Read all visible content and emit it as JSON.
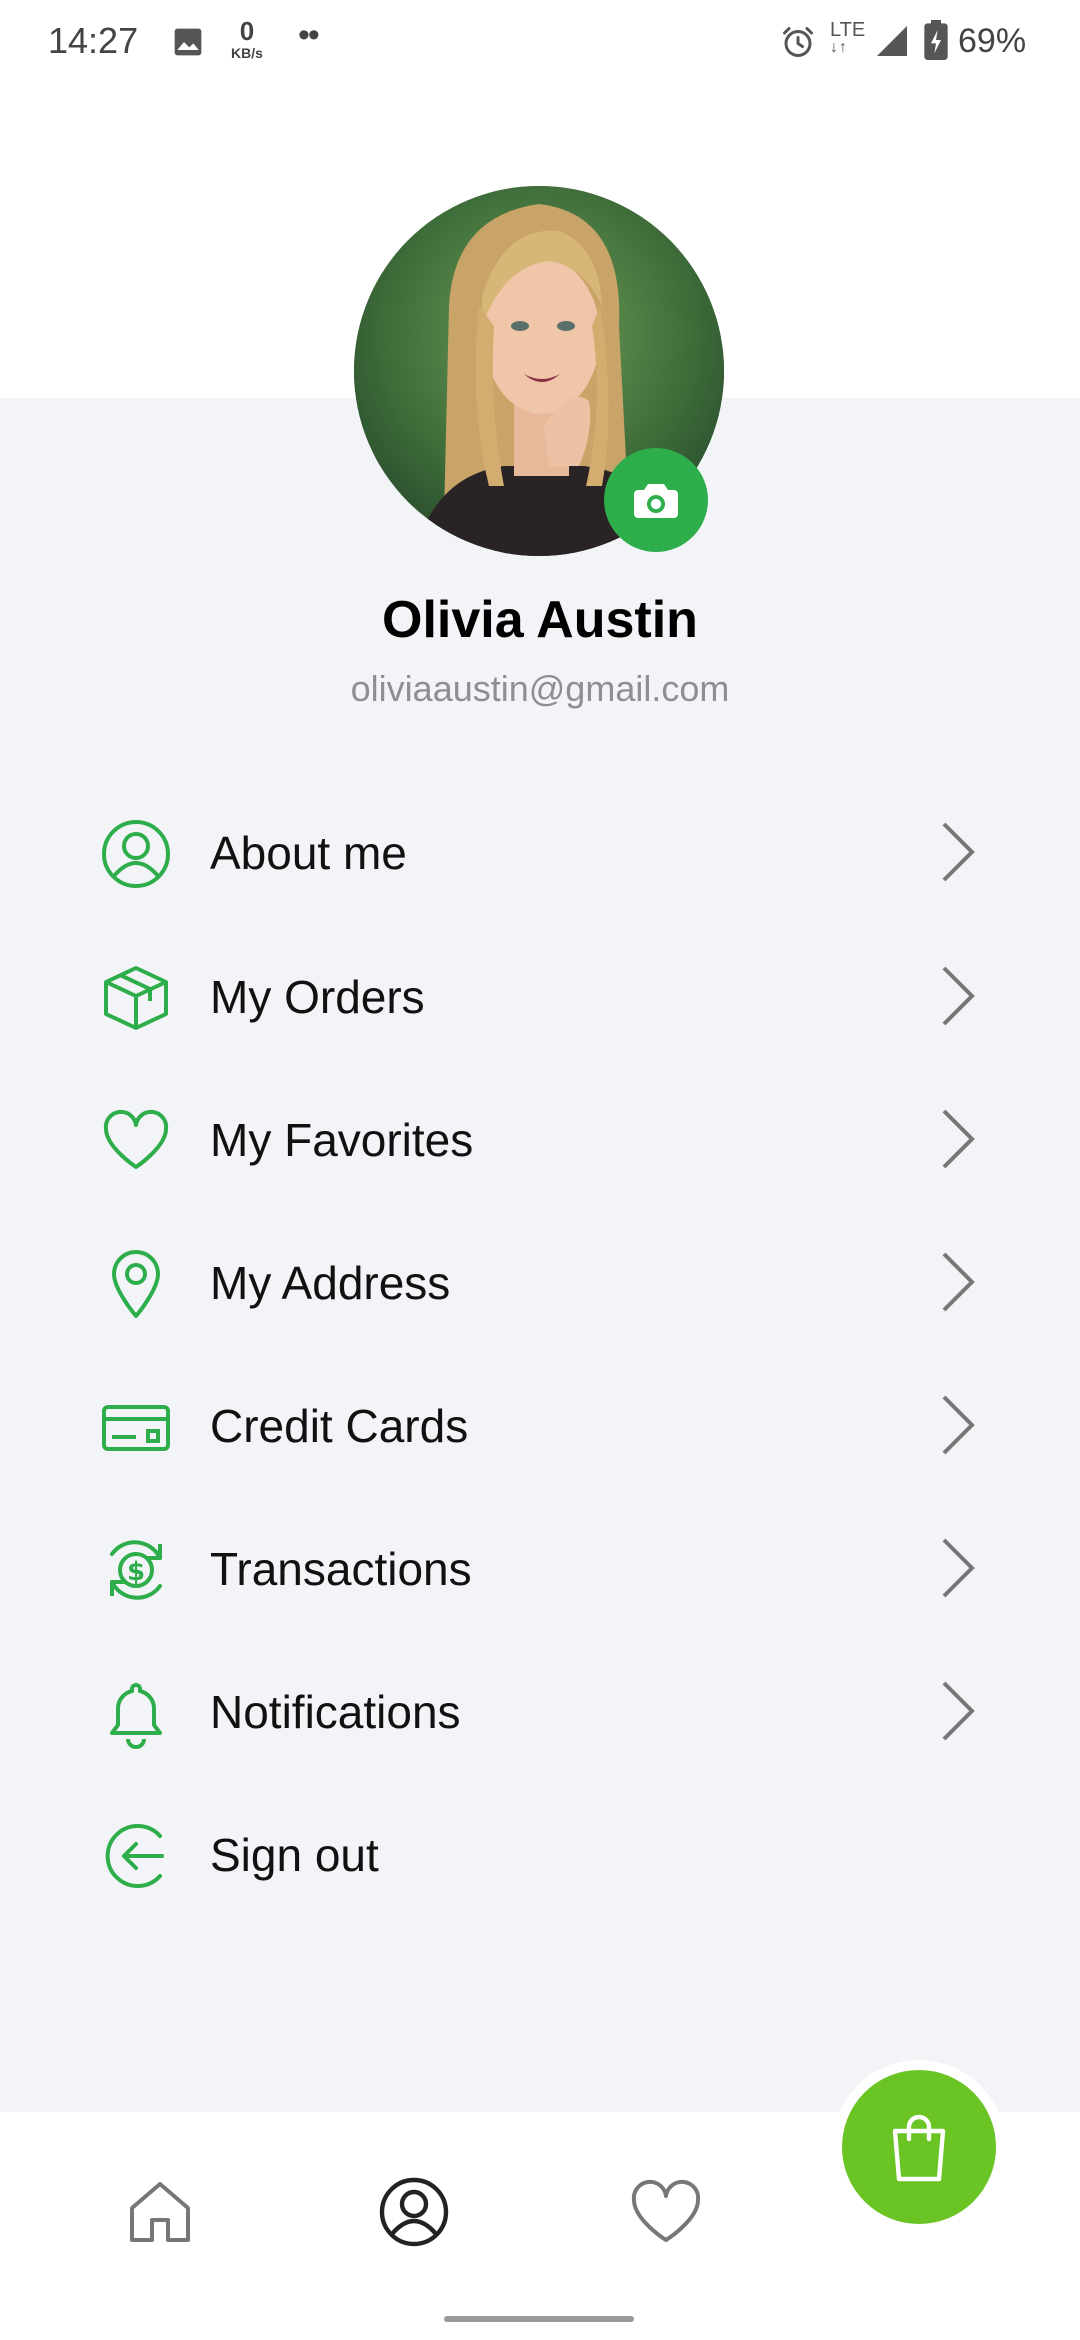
{
  "status_bar": {
    "time": "14:27",
    "speed_value": "0",
    "speed_unit": "KB/s",
    "dots": "••",
    "network": "LTE",
    "battery": "69%",
    "icons": [
      "image-icon",
      "alarm-icon",
      "signal-icon",
      "battery-icon"
    ]
  },
  "profile": {
    "name": "Olivia Austin",
    "email": "oliviaaustin@gmail.com"
  },
  "menu": {
    "items": [
      {
        "label": "About me",
        "icon": "user-circle-icon",
        "chevron": true
      },
      {
        "label": "My Orders",
        "icon": "box-icon",
        "chevron": true
      },
      {
        "label": "My Favorites",
        "icon": "heart-icon",
        "chevron": true
      },
      {
        "label": "My Address",
        "icon": "location-pin-icon",
        "chevron": true
      },
      {
        "label": "Credit Cards",
        "icon": "credit-card-icon",
        "chevron": true
      },
      {
        "label": "Transactions",
        "icon": "dollar-cycle-icon",
        "chevron": true
      },
      {
        "label": "Notifications",
        "icon": "bell-icon",
        "chevron": true
      },
      {
        "label": "Sign out",
        "icon": "sign-out-icon",
        "chevron": false
      }
    ]
  },
  "bottom_nav": {
    "items": [
      "home-icon",
      "profile-icon",
      "heart-icon",
      "shopping-bag-icon"
    ],
    "active": "profile-icon"
  },
  "colors": {
    "accent_green": "#2ead4b",
    "fab_green": "#6ac424",
    "background": "#f3f4f8",
    "secondary_text": "#8e8e93"
  }
}
